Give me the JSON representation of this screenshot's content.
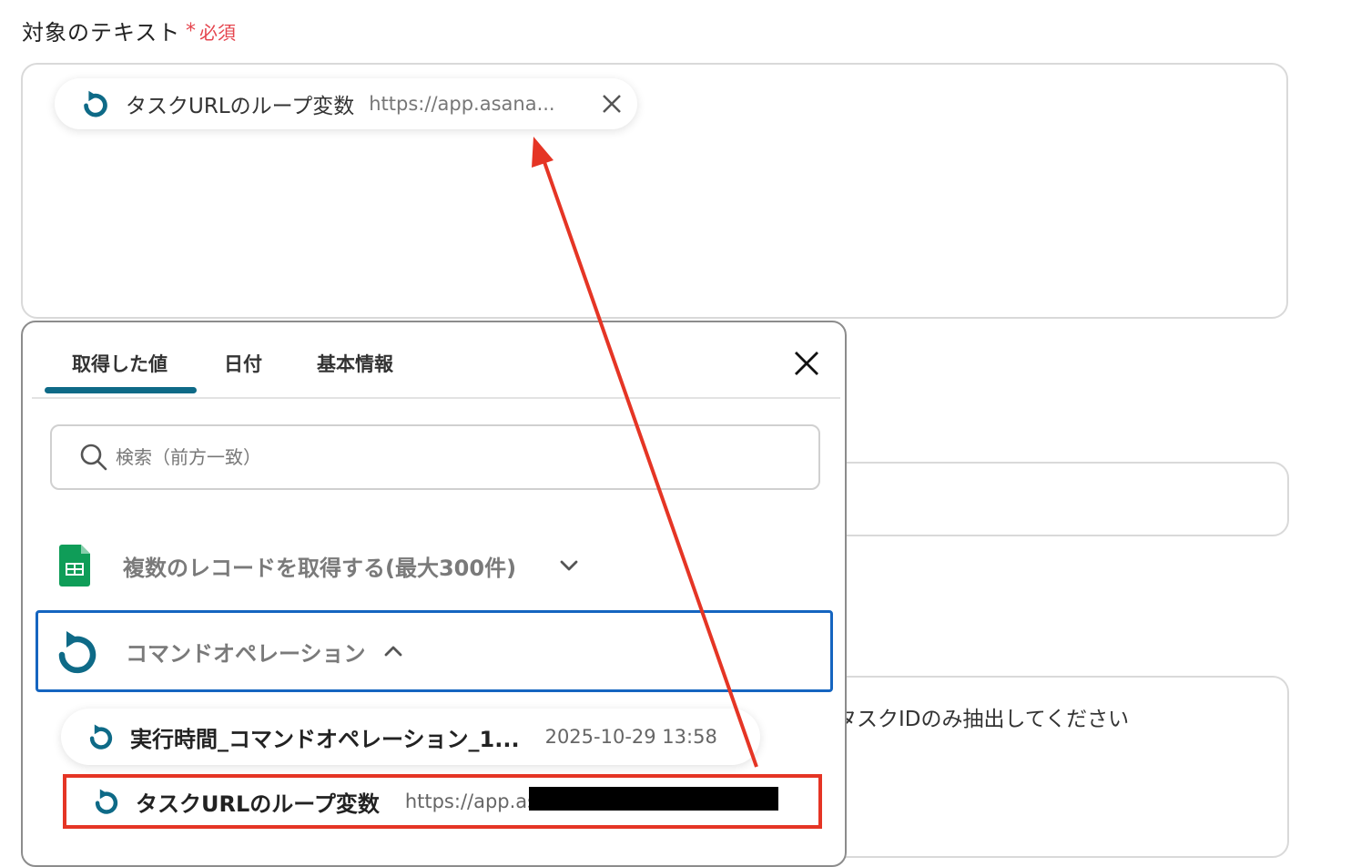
{
  "field": {
    "label": "対象のテキスト",
    "required_mark": "*",
    "required_text": "必須"
  },
  "chip": {
    "label": "タスクURLのループ変数",
    "value": "https://app.asana..."
  },
  "background": {
    "field_text": "タスクIDのみ抽出してください"
  },
  "panel": {
    "tabs": [
      "取得した値",
      "日付",
      "基本情報"
    ],
    "active_tab": "取得した値",
    "search_placeholder": "検索（前方一致）",
    "groups": [
      {
        "label": "複数のレコードを取得する(最大300件)",
        "icon": "google-sheets-icon",
        "expanded": false
      },
      {
        "label": "コマンドオペレーション",
        "icon": "loop-icon",
        "expanded": true
      }
    ],
    "items": [
      {
        "label": "実行時間_コマンドオペレーション_1...",
        "value": "2025-10-29 13:58"
      },
      {
        "label": "タスクURLのループ変数",
        "value": "https://app.as"
      }
    ]
  },
  "colors": {
    "accent": "#0e6a87",
    "required": "#e5454e",
    "selected_border": "#1565c0",
    "highlight": "#e53525",
    "sheets_green": "#0f9d58"
  }
}
